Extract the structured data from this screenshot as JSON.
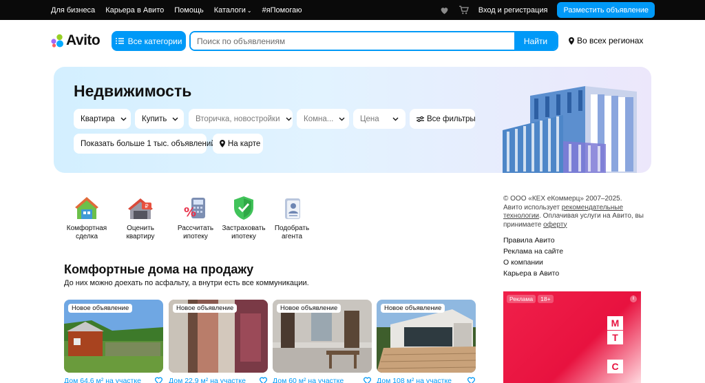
{
  "topbar": {
    "links": [
      "Для бизнеса",
      "Карьера в Авито",
      "Помощь",
      "Каталоги",
      "#яПомогаю"
    ],
    "catalog_chevron": "chevron-down-icon",
    "login": "Вход и регистрация",
    "post_button": "Разместить объявление"
  },
  "header": {
    "logo": "Avito",
    "categories_button": "Все категории",
    "search_placeholder": "Поиск по объявлениям",
    "search_button": "Найти",
    "region": "Во всех регионах"
  },
  "hero": {
    "title": "Недвижимость",
    "filters": {
      "type": "Квартира",
      "deal": "Купить",
      "market": "Вторичка, новостройки",
      "rooms": "Комна...",
      "price": "Цена",
      "all_filters": "Все фильтры"
    },
    "show_more": "Показать больше 1 тыс. объявлений",
    "map_button": "На карте"
  },
  "services": [
    {
      "label": "Комфортная сделка",
      "icon": "house-deal-icon"
    },
    {
      "label": "Оценить квартиру",
      "icon": "price-tag-house-icon"
    },
    {
      "label": "Рассчитать ипотеку",
      "icon": "calculator-icon"
    },
    {
      "label": "Застраховать ипотеку",
      "icon": "shield-check-icon"
    },
    {
      "label": "Подобрать агента",
      "icon": "agent-card-icon"
    }
  ],
  "section": {
    "title": "Комфортные дома на продажу",
    "subtitle": "До них можно доехать по асфальту, а внутри есть все коммуникации."
  },
  "listings": [
    {
      "badge": "Новое объявление",
      "title": "Дом 64,6 м² на участке"
    },
    {
      "badge": "Новое объявление",
      "title": "Дом 22,9 м² на участке"
    },
    {
      "badge": "Новое объявление",
      "title": "Дом 60 м² на участке"
    },
    {
      "badge": "Новое объявление",
      "title": "Дом 108 м² на участке"
    }
  ],
  "sidebar": {
    "copyright": "© ООО «КЕХ еКоммерц» 2007–2025.",
    "legal_1": "Авито использует ",
    "legal_link_1": "рекомендательные технологии",
    "legal_2": ". Оплачивая услуги на Авито, вы принимаете ",
    "legal_link_2": "оферту",
    "links": [
      "Правила Авито",
      "Реклама на сайте",
      "О компании",
      "Карьера в Авито"
    ]
  },
  "ad": {
    "label": "Реклама",
    "age": "18+",
    "info": "i",
    "brand": [
      "М",
      "Т",
      "С"
    ]
  },
  "colors": {
    "accent": "#0099f7",
    "topbar": "#0a0a0a",
    "ad_red": "#e8123f"
  }
}
